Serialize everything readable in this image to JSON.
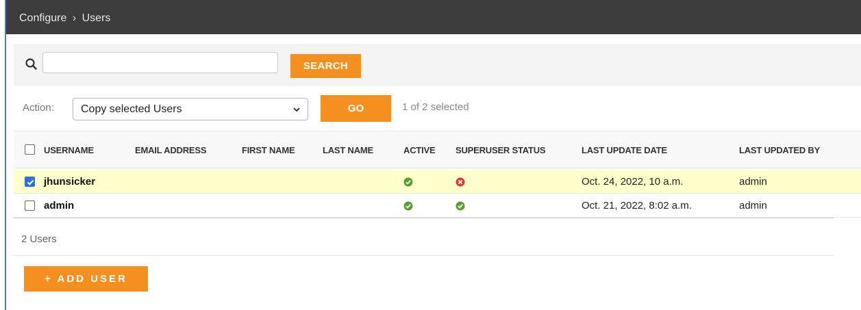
{
  "breadcrumb": {
    "parent": "Configure",
    "separator": "›",
    "current": "Users"
  },
  "search": {
    "value": "",
    "placeholder": "",
    "button_label": "SEARCH",
    "icon": "search-icon"
  },
  "actions": {
    "label": "Action:",
    "selected_option": "Copy selected Users",
    "go_label": "GO",
    "selection_count": "1 of 2 selected"
  },
  "table": {
    "columns": [
      "USERNAME",
      "EMAIL ADDRESS",
      "FIRST NAME",
      "LAST NAME",
      "ACTIVE",
      "SUPERUSER STATUS",
      "LAST UPDATE DATE",
      "LAST UPDATED BY"
    ],
    "rows": [
      {
        "selected": true,
        "username": "jhunsicker",
        "email": "",
        "first_name": "",
        "last_name": "",
        "active": true,
        "superuser": false,
        "last_update_date": "Oct. 24, 2022, 10 a.m.",
        "last_updated_by": "admin"
      },
      {
        "selected": false,
        "username": "admin",
        "email": "",
        "first_name": "",
        "last_name": "",
        "active": true,
        "superuser": true,
        "last_update_date": "Oct. 21, 2022, 8:02 a.m.",
        "last_updated_by": "admin"
      }
    ]
  },
  "footer": {
    "count_text": "2 Users",
    "add_label": "+ ADD USER"
  },
  "colors": {
    "accent": "#f5901e",
    "topbar": "#3c3c3c",
    "selected_row": "#ffffcc",
    "yes": "#5aa02c",
    "no": "#d93b3b",
    "checkbox": "#2f6fd6"
  }
}
